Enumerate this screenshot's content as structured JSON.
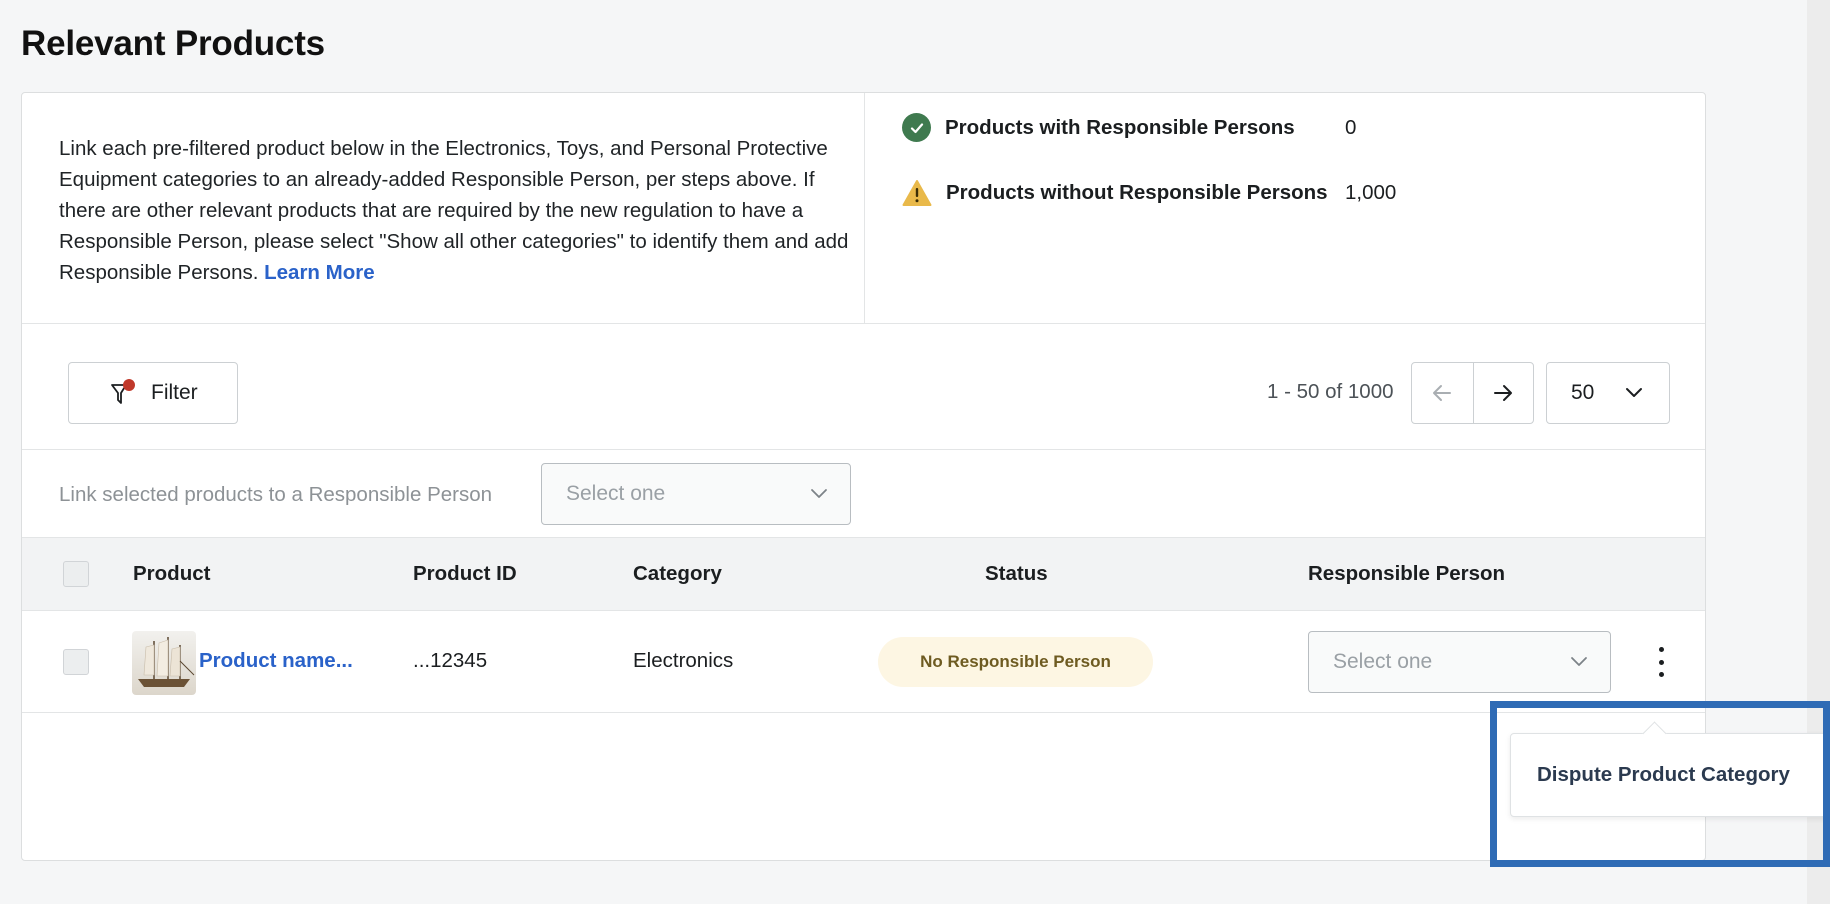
{
  "page": {
    "title": "Relevant Products"
  },
  "info": {
    "description": "Link each pre-filtered product below in the Electronics, Toys, and Personal Protective Equipment categories to an already-added Responsible Person, per steps above. If there are other relevant products that are required by the new regulation to have a Responsible Person, please select \"Show all other categories\" to identify them and add Responsible Persons.",
    "learn_more": "Learn More"
  },
  "stats": {
    "with": {
      "label": "Products with Responsible Persons",
      "value": "0"
    },
    "without": {
      "label": "Products without Responsible Persons",
      "value": "1,000"
    }
  },
  "toolbar": {
    "filter_label": "Filter",
    "range": "1 - 50 of 1000",
    "per_page": "50"
  },
  "bulk": {
    "label": "Link selected products to a Responsible Person",
    "placeholder": "Select one"
  },
  "table": {
    "headers": {
      "product": "Product",
      "product_id": "Product ID",
      "category": "Category",
      "status": "Status",
      "responsible": "Responsible Person"
    },
    "rows": [
      {
        "name": "Product name...",
        "id": "...12345",
        "category": "Electronics",
        "status": "No Responsible Person",
        "responsible_placeholder": "Select one"
      }
    ]
  },
  "menu": {
    "items": [
      "Dispute Product Category"
    ]
  },
  "colors": {
    "accent": "#2a62c9",
    "success": "#3f7a4f",
    "warning": "#e9b94a",
    "highlight": "#2f6bb5"
  },
  "icons": [
    "check-icon",
    "warning-icon",
    "filter-icon",
    "arrow-left-icon",
    "arrow-right-icon",
    "chevron-down-icon",
    "kebab-icon"
  ]
}
